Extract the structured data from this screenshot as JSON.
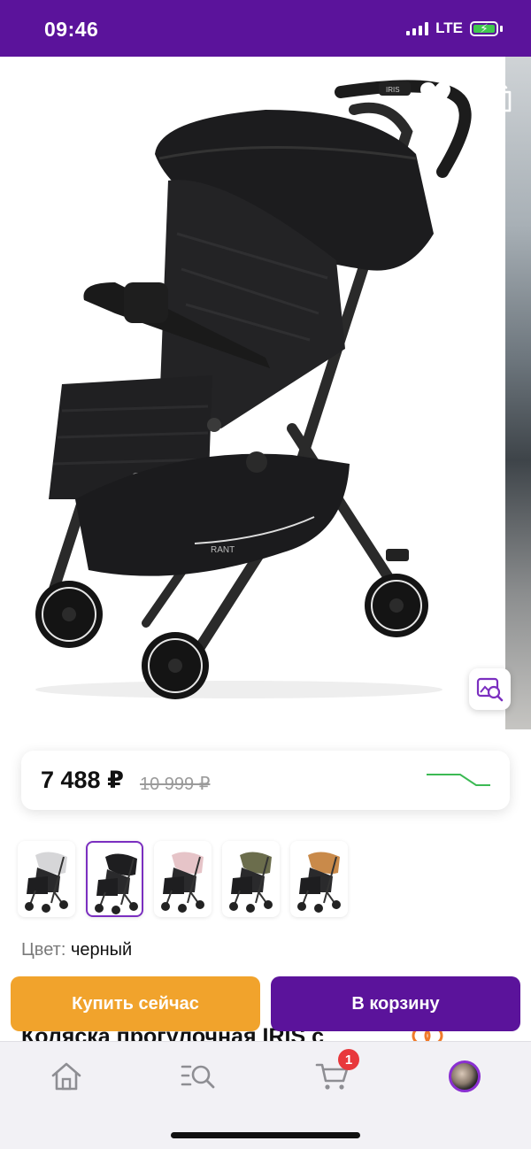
{
  "status_bar": {
    "time": "09:46",
    "network": "LTE",
    "signal_bars": 4,
    "battery_charging": true
  },
  "gallery": {
    "icons": {
      "back": "chevron-left-icon",
      "favorite": "heart-icon",
      "share": "share-icon",
      "visual_search": "image-search-icon"
    },
    "stroller_badge_text": "IRIS",
    "stroller_logo_text": "RANT"
  },
  "price": {
    "current": "7 488 ₽",
    "old": "10 999 ₽",
    "trend_color": "#3cba54"
  },
  "color_options": [
    {
      "name": "серый",
      "canopy": "#d6d6d8",
      "selected": false
    },
    {
      "name": "черный",
      "canopy": "#1e1e20",
      "selected": true
    },
    {
      "name": "розовый",
      "canopy": "#e6c4c8",
      "selected": false
    },
    {
      "name": "оливковый",
      "canopy": "#6b6d4c",
      "selected": false
    },
    {
      "name": "коричневый",
      "canopy": "#c98a4a",
      "selected": false
    }
  ],
  "color": {
    "label": "Цвет:",
    "value": "черный"
  },
  "product": {
    "title": "Коляска прогулочная IRIS с"
  },
  "actions": {
    "buy_now": "Купить сейчас",
    "add_to_cart": "В корзину"
  },
  "colors": {
    "brand_purple": "#5b139b",
    "buy_orange": "#f1a32c",
    "badge_red": "#e8383c"
  },
  "bottom_nav": {
    "items": [
      {
        "id": "home",
        "icon": "home-icon"
      },
      {
        "id": "catalog",
        "icon": "catalog-search-icon"
      },
      {
        "id": "cart",
        "icon": "cart-icon",
        "badge": "1"
      },
      {
        "id": "profile",
        "icon": "avatar"
      }
    ]
  }
}
